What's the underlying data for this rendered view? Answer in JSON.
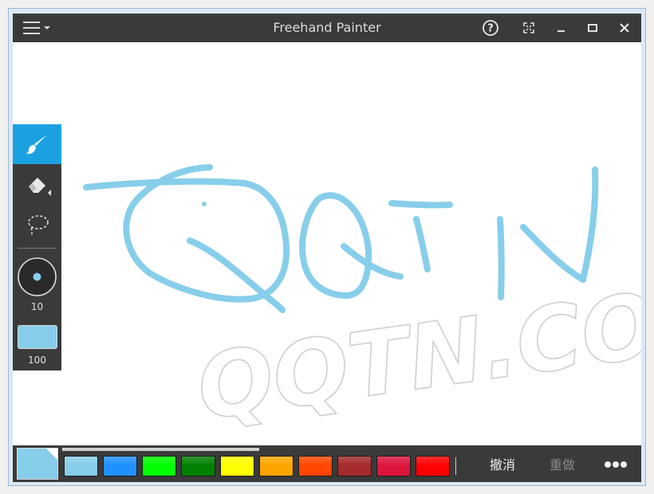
{
  "window": {
    "title": "Freehand Painter",
    "controls": [
      "help-icon",
      "fullscreen-icon",
      "minimize-icon",
      "maximize-icon",
      "close-icon"
    ]
  },
  "left_toolbar": {
    "tools": [
      {
        "name": "brush-tool",
        "icon": "brush-icon",
        "active": true
      },
      {
        "name": "eraser-tool",
        "icon": "eraser-icon",
        "active": false
      },
      {
        "name": "lasso-tool",
        "icon": "lasso-icon",
        "active": false
      }
    ],
    "brush_size": "10",
    "opacity": "100",
    "current_color": "#87ceeb"
  },
  "canvas": {
    "handwriting_text": "QQTN",
    "stroke_color": "#87ceeb",
    "watermark": "QQTN.COM"
  },
  "bottom_bar": {
    "selected_color": "#87ceeb",
    "palette": [
      "#87ceeb",
      "#1e90ff",
      "#00ff00",
      "#008000",
      "#ffff00",
      "#ffa500",
      "#ff4500",
      "#a52a2a",
      "#dc143c",
      "#ff0000"
    ],
    "undo_label": "撤消",
    "redo_label": "重做",
    "more_icon": "more-icon"
  }
}
